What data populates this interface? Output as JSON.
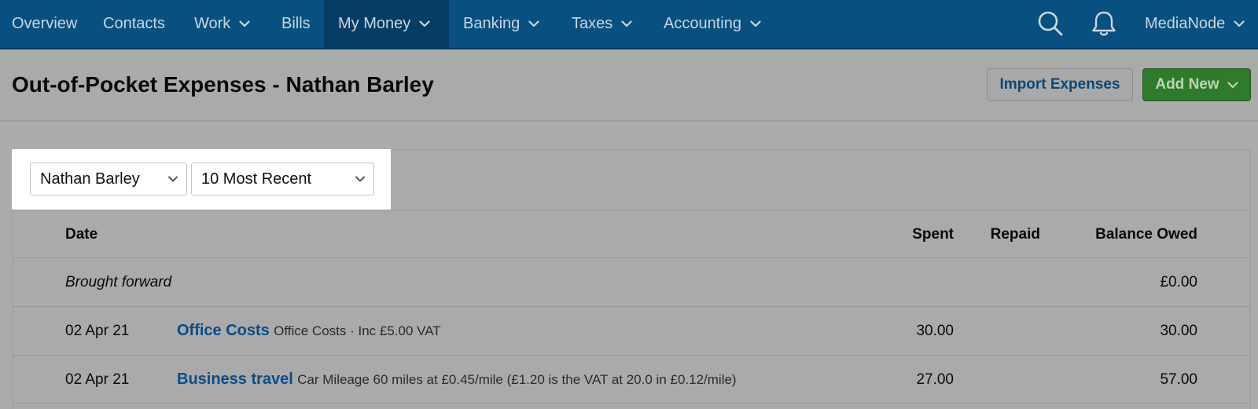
{
  "nav": {
    "items": [
      {
        "label": "Overview"
      },
      {
        "label": "Contacts"
      },
      {
        "label": "Work"
      },
      {
        "label": "Bills"
      },
      {
        "label": "My Money"
      },
      {
        "label": "Banking"
      },
      {
        "label": "Taxes"
      },
      {
        "label": "Accounting"
      }
    ],
    "account": "MediaNode",
    "search_icon": "search-icon",
    "bell_icon": "bell-icon"
  },
  "header": {
    "title": "Out-of-Pocket Expenses - Nathan Barley",
    "import_label": "Import Expenses",
    "add_label": "Add New"
  },
  "filters": {
    "person": "Nathan Barley",
    "range": "10 Most Recent"
  },
  "table": {
    "columns": {
      "date": "Date",
      "spent": "Spent",
      "repaid": "Repaid",
      "balance": "Balance Owed"
    },
    "brought_forward": {
      "label": "Brought forward",
      "balance": "£0.00"
    },
    "rows": [
      {
        "date": "02 Apr 21",
        "category": "Office Costs",
        "description": "Office Costs · Inc £5.00 VAT",
        "spent": "30.00",
        "repaid": "",
        "balance": "30.00"
      },
      {
        "date": "02 Apr 21",
        "category": "Business travel",
        "description": "Car Mileage 60 miles at £0.45/mile (£1.20 is the VAT at 20.0 in £0.12/mile)",
        "spent": "27.00",
        "repaid": "",
        "balance": "57.00"
      }
    ]
  },
  "colors": {
    "nav_bg": "#07507f",
    "add_button": "#2f7a2b",
    "link": "#0a4c86"
  }
}
